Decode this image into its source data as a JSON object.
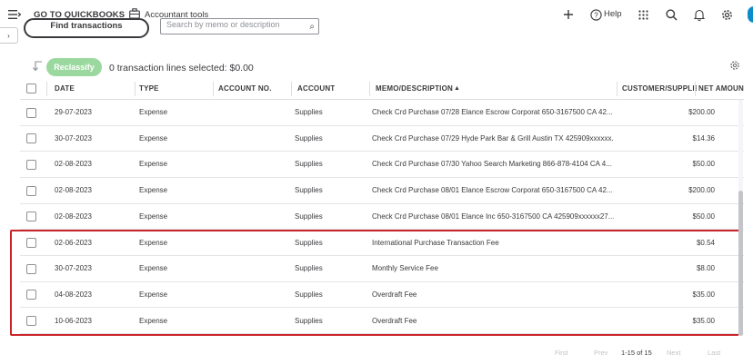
{
  "topbar": {
    "go_to_label": "GO TO QUICKBOOKS",
    "accountant_tools_label": "Accountant tools",
    "help_label": "Help"
  },
  "icons": {
    "menu": "menu-icon",
    "chevron": "chevron-down-icon",
    "briefcase": "briefcase-icon",
    "plus": "plus-icon",
    "help": "help-icon",
    "apps": "apps-grid-icon",
    "search": "search-icon",
    "bell": "bell-icon",
    "gear": "gear-icon"
  },
  "filter": {
    "find_label": "Find transactions",
    "search_placeholder": "Search by memo or description"
  },
  "actions": {
    "reclassify_label": "Reclassify",
    "selected_text": "0 transaction lines selected: $0.00"
  },
  "table": {
    "headers": {
      "date": "DATE",
      "type": "TYPE",
      "account_no": "ACCOUNT NO.",
      "account": "ACCOUNT",
      "memo": "MEMO/DESCRIPTION",
      "memo_sort": "▲",
      "customer": "CUSTOMER/SUPPLIER",
      "net_amount": "NET AMOUNT"
    },
    "rows": [
      {
        "date": "29-07-2023",
        "type": "Expense",
        "account_no": "",
        "account": "Supplies",
        "memo": "Check Crd Purchase 07/28 Elance Escrow Corporat 650-3167500 CA 42...",
        "customer": "",
        "amount": "$200.00"
      },
      {
        "date": "30-07-2023",
        "type": "Expense",
        "account_no": "",
        "account": "Supplies",
        "memo": "Check Crd Purchase 07/29 Hyde Park Bar & Grill Austin TX 425909xxxxxx...",
        "customer": "",
        "amount": "$14.36"
      },
      {
        "date": "02-08-2023",
        "type": "Expense",
        "account_no": "",
        "account": "Supplies",
        "memo": "Check Crd Purchase 07/30 Yahoo Search Marketing 866-878-4104 CA 4...",
        "customer": "",
        "amount": "$50.00"
      },
      {
        "date": "02-08-2023",
        "type": "Expense",
        "account_no": "",
        "account": "Supplies",
        "memo": "Check Crd Purchase 08/01 Elance Escrow Corporat 650-3167500 CA 42...",
        "customer": "",
        "amount": "$200.00"
      },
      {
        "date": "02-08-2023",
        "type": "Expense",
        "account_no": "",
        "account": "Supplies",
        "memo": "Check Crd Purchase 08/01 Elance Inc 650-3167500 CA 425909xxxxxx27...",
        "customer": "",
        "amount": "$50.00"
      },
      {
        "date": "02-06-2023",
        "type": "Expense",
        "account_no": "",
        "account": "Supplies",
        "memo": "International Purchase Transaction Fee",
        "customer": "",
        "amount": "$0.54"
      },
      {
        "date": "30-07-2023",
        "type": "Expense",
        "account_no": "",
        "account": "Supplies",
        "memo": "Monthly Service Fee",
        "customer": "",
        "amount": "$8.00"
      },
      {
        "date": "04-08-2023",
        "type": "Expense",
        "account_no": "",
        "account": "Supplies",
        "memo": "Overdraft Fee",
        "customer": "",
        "amount": "$35.00"
      },
      {
        "date": "10-06-2023",
        "type": "Expense",
        "account_no": "",
        "account": "Supplies",
        "memo": "Overdraft Fee",
        "customer": "",
        "amount": "$35.00"
      }
    ]
  },
  "pagination": {
    "first": "First",
    "prev": "Prev",
    "range": "1-15 of 15",
    "next": "Next",
    "last": "Last"
  },
  "colors": {
    "highlight": "#c9252b",
    "reclassify_bg": "#9bd89f",
    "text": "#393a3d",
    "accent_blue": "#0d8ccb"
  }
}
